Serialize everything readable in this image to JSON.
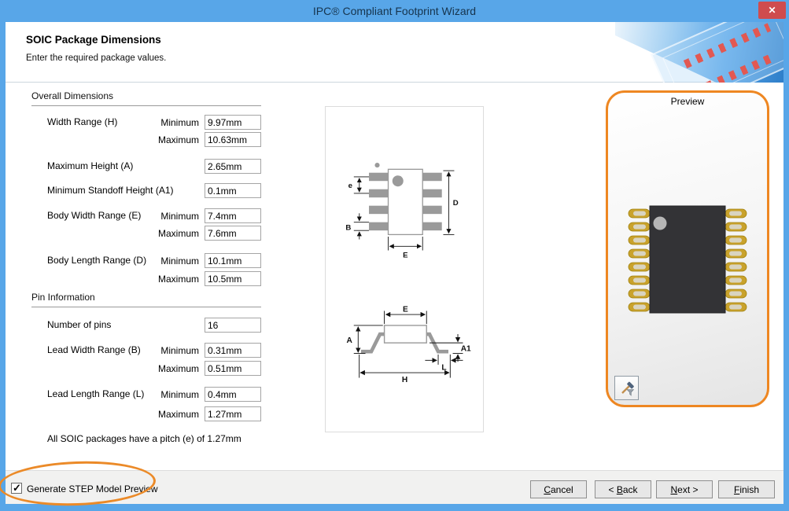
{
  "window": {
    "title": "IPC® Compliant Footprint Wizard",
    "close_glyph": "✕"
  },
  "header": {
    "title": "SOIC Package Dimensions",
    "subtitle": "Enter the required package values."
  },
  "form": {
    "section1_title": "Overall Dimensions",
    "section2_title": "Pin Information",
    "rows": [
      {
        "label": "Width Range (H)",
        "minLabel": "Minimum",
        "min": "9.97mm",
        "maxLabel": "Maximum",
        "max": "10.63mm"
      },
      {
        "label": "Maximum Height (A)",
        "value": "2.65mm"
      },
      {
        "label": "Minimum Standoff Height (A1)",
        "value": "0.1mm"
      },
      {
        "label": "Body Width Range (E)",
        "minLabel": "Minimum",
        "min": "7.4mm",
        "maxLabel": "Maximum",
        "max": "7.6mm"
      },
      {
        "label": "Body Length Range (D)",
        "minLabel": "Minimum",
        "min": "10.1mm",
        "maxLabel": "Maximum",
        "max": "10.5mm"
      },
      {
        "label": "Number of pins",
        "value": "16"
      },
      {
        "label": "Lead Width Range (B)",
        "minLabel": "Minimum",
        "min": "0.31mm",
        "maxLabel": "Maximum",
        "max": "0.51mm"
      },
      {
        "label": "Lead Length Range (L)",
        "minLabel": "Minimum",
        "min": "0.4mm",
        "maxLabel": "Maximum",
        "max": "1.27mm"
      }
    ],
    "note": "All SOIC packages have a pitch (e) of 1.27mm"
  },
  "diagram": {
    "top": {
      "e": "e",
      "B": "B",
      "D": "D",
      "E": "E"
    },
    "side": {
      "E": "E",
      "A": "A",
      "A1": "A1",
      "H": "H",
      "L": "L"
    }
  },
  "preview": {
    "title": "Preview"
  },
  "footer": {
    "checkbox_label": "Generate STEP Model Preview",
    "checkbox_checked": true,
    "cancel": {
      "pre": "",
      "accel": "C",
      "rest": "ancel"
    },
    "back": {
      "pre": "< ",
      "accel": "B",
      "rest": "ack"
    },
    "next": {
      "pre": "",
      "accel": "N",
      "rest": "ext >"
    },
    "finish": {
      "pre": "",
      "accel": "F",
      "rest": "inish"
    }
  },
  "colors": {
    "titlebar_blue": "#58a6e8",
    "close_red": "#cf4c4e",
    "accent_orange": "#ee8722",
    "chip_body": "#37373a",
    "pin_gold": "#c9a22c",
    "diagram_gray": "#9a9a9a"
  }
}
